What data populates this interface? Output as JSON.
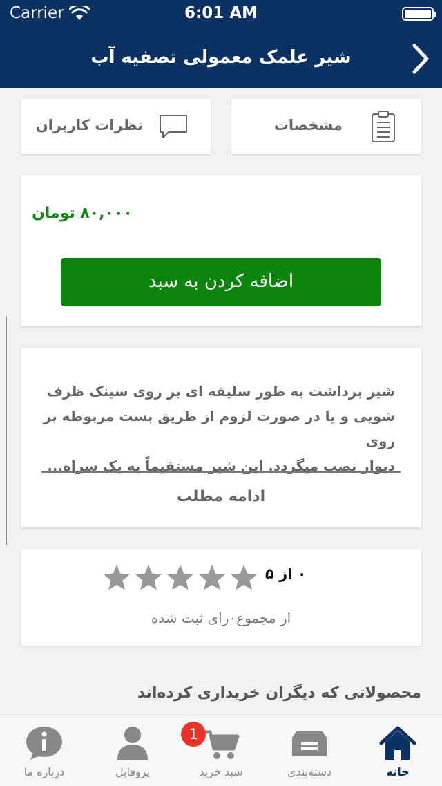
{
  "status_bar": {
    "carrier": "Carrier",
    "time": "6:01 AM"
  },
  "nav": {
    "title": "شیر علمک معمولی تصفیه آب"
  },
  "tabs": {
    "specs": "مشخصات",
    "reviews": "نظرات کاربران"
  },
  "product": {
    "price": "۸۰,۰۰۰ تومان",
    "add_to_cart": "اضافه کردن به سبد",
    "description_lines": [
      "شیر برداشت به طور سلیقه ای بر روی سینک ظرف",
      "شویی و یا در صورت لزوم از طریق بست مربوطه بر روی",
      "دیوار نصب میگردد. این شیر مستقیماً به یک سراه..."
    ],
    "read_more": "ادامه مطلب"
  },
  "rating": {
    "score_text": "۰ از ۵",
    "value": 0,
    "max": 5,
    "votes_text": "از مجموع۰رای ثبت شده"
  },
  "section": {
    "others_bought": "محصولاتی که دیگران خریداری کرده‌اند"
  },
  "tabbar": {
    "home": "خانه",
    "categories": "دسته‌بندی",
    "cart": "سبد خرید",
    "cart_badge": "1",
    "profile": "پروفایل",
    "about": "درباره ما"
  },
  "colors": {
    "brand": "#0b3263",
    "price": "#138a13",
    "button": "#0b840b",
    "badge": "#e8332a",
    "star_empty": "#999999"
  }
}
